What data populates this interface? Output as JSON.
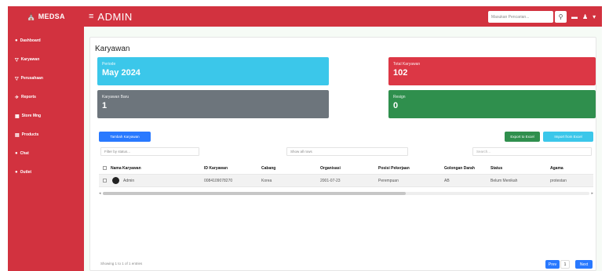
{
  "brand": {
    "icon": "bank-icon",
    "name": "MEDSA"
  },
  "header": {
    "menu_icon": "≡",
    "title": "ADMIN",
    "search_placeholder": "Masukan Pencarian...",
    "search_icon": "⚲",
    "icons": [
      "▬",
      "♟",
      "▾"
    ]
  },
  "sidebar": {
    "items": [
      {
        "icon": "●",
        "label": "Dashboard"
      },
      {
        "icon": "▽",
        "label": "Karyawan"
      },
      {
        "icon": "▽",
        "label": "Perusahaan"
      },
      {
        "icon": "✈",
        "label": "Reports"
      },
      {
        "icon": "▦",
        "label": "Store Mng"
      },
      {
        "icon": "▤",
        "label": "Products"
      },
      {
        "icon": "●",
        "label": "Chat"
      },
      {
        "icon": "●",
        "label": "Outlet"
      }
    ]
  },
  "page": {
    "title": "Karyawan"
  },
  "stats": {
    "periode": {
      "label": "Periode",
      "value": "May 2024"
    },
    "total": {
      "label": "Total Karyawan",
      "value": "102"
    },
    "baru": {
      "label": "Karyawan Baru",
      "value": "1"
    },
    "resign": {
      "label": "Resign",
      "value": "0"
    }
  },
  "actions": {
    "add": "Tambah Karyawan",
    "export": "Export to Excel",
    "import": "Import from Excel"
  },
  "filters": {
    "status_placeholder": "Filter by status...",
    "rows_value": "Show all rows",
    "search_placeholder": "Search..."
  },
  "table": {
    "columns": [
      "Nama Karyawan",
      "ID Karyawan",
      "Cabang",
      "Organisasi",
      "Posisi Pekerjaan",
      "Golongan Darah",
      "Status",
      "Agama"
    ],
    "rows": [
      [
        "Admin",
        "0084109078270",
        "Korea",
        "2001-07-23",
        "Perempuan",
        "AB",
        "Belum Menikah",
        "protestan"
      ]
    ]
  },
  "footer": {
    "info": "Showing 1 to 1 of 1 entries",
    "prev": "Prev",
    "page": "1",
    "next": "Next"
  }
}
